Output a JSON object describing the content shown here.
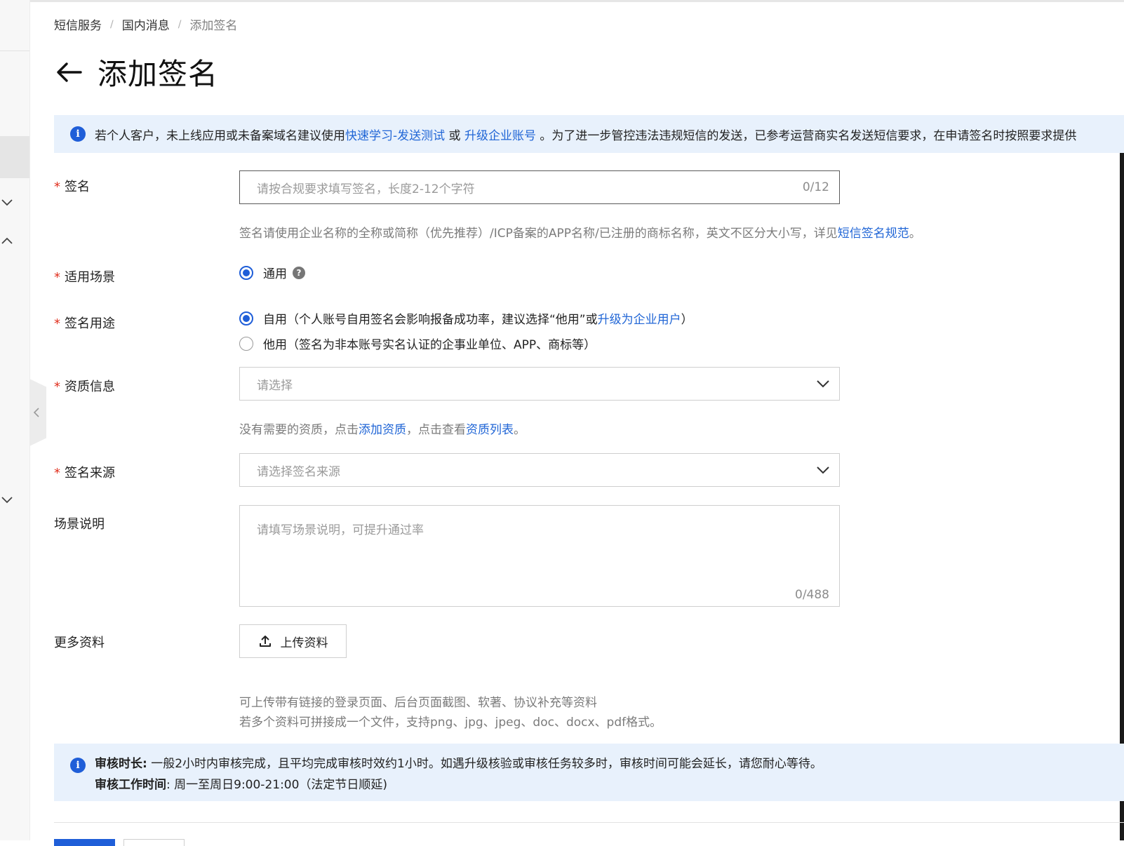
{
  "breadcrumb": {
    "items": [
      "短信服务",
      "国内消息"
    ],
    "current": "添加签名",
    "separator": "/"
  },
  "page": {
    "title": "添加签名"
  },
  "notice_top": {
    "text_before": "若个人客户，未上线应用或未备案域名建议使用",
    "link_quick": "快速学习-发送测试",
    "text_or": " 或 ",
    "link_upgrade": "升级企业账号",
    "text_after": " 。为了进一步管控违法违规短信的发送，已参考运营商实名发送短信要求，在申请签名时按照要求提供"
  },
  "form": {
    "signature": {
      "label": "签名",
      "placeholder": "请按合规要求填写签名，长度2-12个字符",
      "counter": "0/12",
      "help_before": "签名请使用企业名称的全称或简称（优先推荐）/ICP备案的APP名称/已注册的商标名称，英文不区分大小写，详见",
      "help_link": "短信签名规范",
      "help_after": "。"
    },
    "scene": {
      "label": "适用场景",
      "option": "通用",
      "help_icon": "question-icon"
    },
    "usage": {
      "label": "签名用途",
      "self_text": "自用（个人账号自用签名会影响报备成功率，建议选择“他用”或",
      "self_link": "升级为企业用户",
      "self_end": "）",
      "other_text": "他用（签名为非本账号实名认证的企事业单位、APP、商标等）",
      "selected": "自用"
    },
    "qualification": {
      "label": "资质信息",
      "placeholder": "请选择",
      "help_before": "没有需要的资质，点击",
      "help_link_add": "添加资质",
      "help_mid": "，点击查看",
      "help_link_list": "资质列表",
      "help_after": "。"
    },
    "source": {
      "label": "签名来源",
      "placeholder": "请选择签名来源"
    },
    "scene_desc": {
      "label": "场景说明",
      "placeholder": "请填写场景说明，可提升通过率",
      "counter": "0/488"
    },
    "more": {
      "label": "更多资料",
      "upload_label": "上传资料",
      "help_line1": "可上传带有链接的登录页面、后台页面截图、软著、协议补充等资料",
      "help_line2": "若多个资料可拼接成一个文件，支持png、jpg、jpeg、doc、docx、pdf格式。"
    }
  },
  "notice_bottom": {
    "line1_bold": "审核时长:",
    "line1_text": " 一般2小时内审核完成，且平均完成审核时效约1小时。如遇升级核验或审核任务较多时，审核时间可能会延长，请您耐心等待。",
    "line2_bold": "审核工作时间",
    "line2_text": ": 周一至周日9:00-21:00（法定节日顺延)"
  },
  "colors": {
    "primary": "#1f5ed8",
    "link": "#2166d6",
    "required": "#e0301e",
    "notice_bg": "#e8f1fc"
  }
}
